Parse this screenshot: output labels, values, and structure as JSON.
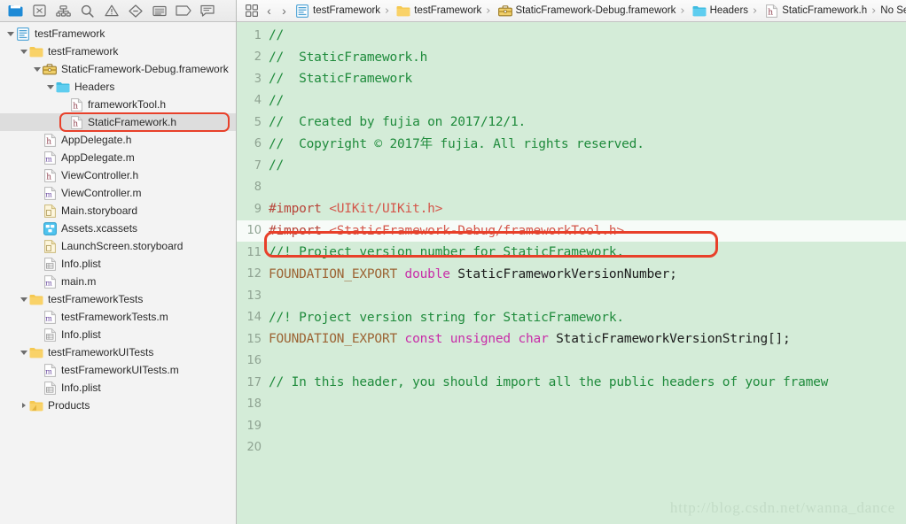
{
  "window": {
    "title": "Xcode — StaticFramework.h"
  },
  "navigator": {
    "toolbar_icons": [
      {
        "name": "project-navigator-icon",
        "label": "Project navigator",
        "active": true
      },
      {
        "name": "source-control-navigator-icon",
        "label": "Source control navigator",
        "active": false
      },
      {
        "name": "symbol-navigator-icon",
        "label": "Symbol navigator",
        "active": false
      },
      {
        "name": "find-navigator-icon",
        "label": "Find navigator",
        "active": false
      },
      {
        "name": "issue-navigator-icon",
        "label": "Issue navigator",
        "active": false
      },
      {
        "name": "test-navigator-icon",
        "label": "Test navigator",
        "active": false
      },
      {
        "name": "debug-navigator-icon",
        "label": "Debug navigator",
        "active": false
      },
      {
        "name": "breakpoint-navigator-icon",
        "label": "Breakpoint navigator",
        "active": false
      },
      {
        "name": "report-navigator-icon",
        "label": "Report navigator",
        "active": false
      }
    ],
    "tree": [
      {
        "label": "testFramework",
        "indent": 0,
        "twisty": "open",
        "icon": "xcode-project-icon",
        "selected": false
      },
      {
        "label": "testFramework",
        "indent": 1,
        "twisty": "open",
        "icon": "folder-yellow-icon",
        "selected": false
      },
      {
        "label": "StaticFramework-Debug.framework",
        "indent": 2,
        "twisty": "open",
        "icon": "framework-briefcase-icon",
        "selected": false
      },
      {
        "label": "Headers",
        "indent": 3,
        "twisty": "open",
        "icon": "folder-cyan-icon",
        "selected": false
      },
      {
        "label": "frameworkTool.h",
        "indent": 4,
        "twisty": "none",
        "icon": "header-file-icon",
        "selected": false
      },
      {
        "label": "StaticFramework.h",
        "indent": 4,
        "twisty": "none",
        "icon": "header-file-icon",
        "selected": true
      },
      {
        "label": "AppDelegate.h",
        "indent": 2,
        "twisty": "none",
        "icon": "header-file-icon",
        "selected": false
      },
      {
        "label": "AppDelegate.m",
        "indent": 2,
        "twisty": "none",
        "icon": "implementation-file-icon",
        "selected": false
      },
      {
        "label": "ViewController.h",
        "indent": 2,
        "twisty": "none",
        "icon": "header-file-icon",
        "selected": false
      },
      {
        "label": "ViewController.m",
        "indent": 2,
        "twisty": "none",
        "icon": "implementation-file-icon",
        "selected": false
      },
      {
        "label": "Main.storyboard",
        "indent": 2,
        "twisty": "none",
        "icon": "storyboard-file-icon",
        "selected": false
      },
      {
        "label": "Assets.xcassets",
        "indent": 2,
        "twisty": "none",
        "icon": "assets-catalog-icon",
        "selected": false
      },
      {
        "label": "LaunchScreen.storyboard",
        "indent": 2,
        "twisty": "none",
        "icon": "storyboard-file-icon",
        "selected": false
      },
      {
        "label": "Info.plist",
        "indent": 2,
        "twisty": "none",
        "icon": "plist-file-icon",
        "selected": false
      },
      {
        "label": "main.m",
        "indent": 2,
        "twisty": "none",
        "icon": "implementation-file-icon",
        "selected": false
      },
      {
        "label": "testFrameworkTests",
        "indent": 1,
        "twisty": "open",
        "icon": "folder-yellow-icon",
        "selected": false
      },
      {
        "label": "testFrameworkTests.m",
        "indent": 2,
        "twisty": "none",
        "icon": "implementation-file-icon",
        "selected": false
      },
      {
        "label": "Info.plist",
        "indent": 2,
        "twisty": "none",
        "icon": "plist-file-icon",
        "selected": false
      },
      {
        "label": "testFrameworkUITests",
        "indent": 1,
        "twisty": "open",
        "icon": "folder-yellow-icon",
        "selected": false
      },
      {
        "label": "testFrameworkUITests.m",
        "indent": 2,
        "twisty": "none",
        "icon": "implementation-file-icon",
        "selected": false
      },
      {
        "label": "Info.plist",
        "indent": 2,
        "twisty": "none",
        "icon": "plist-file-icon",
        "selected": false
      },
      {
        "label": "Products",
        "indent": 1,
        "twisty": "closed",
        "icon": "folder-products-icon",
        "selected": false
      }
    ]
  },
  "jumpbar": {
    "related_items_label": "Related items",
    "back_label": "‹",
    "forward_label": "›",
    "separator": "›",
    "crumbs": [
      {
        "label": "testFramework",
        "icon": "xcode-project-icon"
      },
      {
        "label": "testFramework",
        "icon": "folder-yellow-icon"
      },
      {
        "label": "StaticFramework-Debug.framework",
        "icon": "framework-briefcase-icon"
      },
      {
        "label": "Headers",
        "icon": "folder-cyan-icon"
      },
      {
        "label": "StaticFramework.h",
        "icon": "header-file-icon"
      },
      {
        "label": "No Se",
        "icon": "none"
      }
    ]
  },
  "editor": {
    "background_color": "#d4ecd8",
    "current_line": 10,
    "lines": [
      {
        "n": "1",
        "tokens": [
          {
            "t": "//",
            "c": "comment"
          }
        ]
      },
      {
        "n": "2",
        "tokens": [
          {
            "t": "//  StaticFramework.h",
            "c": "comment"
          }
        ]
      },
      {
        "n": "3",
        "tokens": [
          {
            "t": "//  StaticFramework",
            "c": "comment"
          }
        ]
      },
      {
        "n": "4",
        "tokens": [
          {
            "t": "//",
            "c": "comment"
          }
        ]
      },
      {
        "n": "5",
        "tokens": [
          {
            "t": "//  Created by fujia on 2017/12/1.",
            "c": "comment"
          }
        ]
      },
      {
        "n": "6",
        "tokens": [
          {
            "t": "//  Copyright © 2017年 fujia. All rights reserved.",
            "c": "comment"
          }
        ]
      },
      {
        "n": "7",
        "tokens": [
          {
            "t": "//",
            "c": "comment"
          }
        ]
      },
      {
        "n": "8",
        "tokens": []
      },
      {
        "n": "9",
        "tokens": [
          {
            "t": "#import ",
            "c": "pre"
          },
          {
            "t": "<UIKit/UIKit.h>",
            "c": "inc"
          }
        ]
      },
      {
        "n": "10",
        "tokens": [
          {
            "t": "#import ",
            "c": "pre"
          },
          {
            "t": "<StaticFramework-Debug/frameworkTool.h>",
            "c": "inc"
          }
        ]
      },
      {
        "n": "11",
        "tokens": [
          {
            "t": "//! Project version number for StaticFramework.",
            "c": "comment"
          }
        ]
      },
      {
        "n": "12",
        "tokens": [
          {
            "t": "FOUNDATION_EXPORT ",
            "c": "macro"
          },
          {
            "t": "double ",
            "c": "kw"
          },
          {
            "t": "StaticFrameworkVersionNumber;",
            "c": "ident"
          }
        ]
      },
      {
        "n": "13",
        "tokens": []
      },
      {
        "n": "14",
        "tokens": [
          {
            "t": "//! Project version string for StaticFramework.",
            "c": "comment"
          }
        ]
      },
      {
        "n": "15",
        "tokens": [
          {
            "t": "FOUNDATION_EXPORT ",
            "c": "macro"
          },
          {
            "t": "const unsigned char ",
            "c": "kw"
          },
          {
            "t": "StaticFrameworkVersionString[];",
            "c": "ident"
          }
        ]
      },
      {
        "n": "16",
        "tokens": []
      },
      {
        "n": "17",
        "tokens": [
          {
            "t": "// In this header, you should import all the public headers of your framew",
            "c": "comment"
          }
        ]
      },
      {
        "n": "18",
        "tokens": []
      },
      {
        "n": "19",
        "tokens": []
      },
      {
        "n": "20",
        "tokens": []
      }
    ]
  },
  "annotations": {
    "sidebar_highlight_color": "#e8402a",
    "code_highlight_color": "#e8402a"
  },
  "watermark": {
    "text": "http://blog.csdn.net/wanna_dance"
  }
}
